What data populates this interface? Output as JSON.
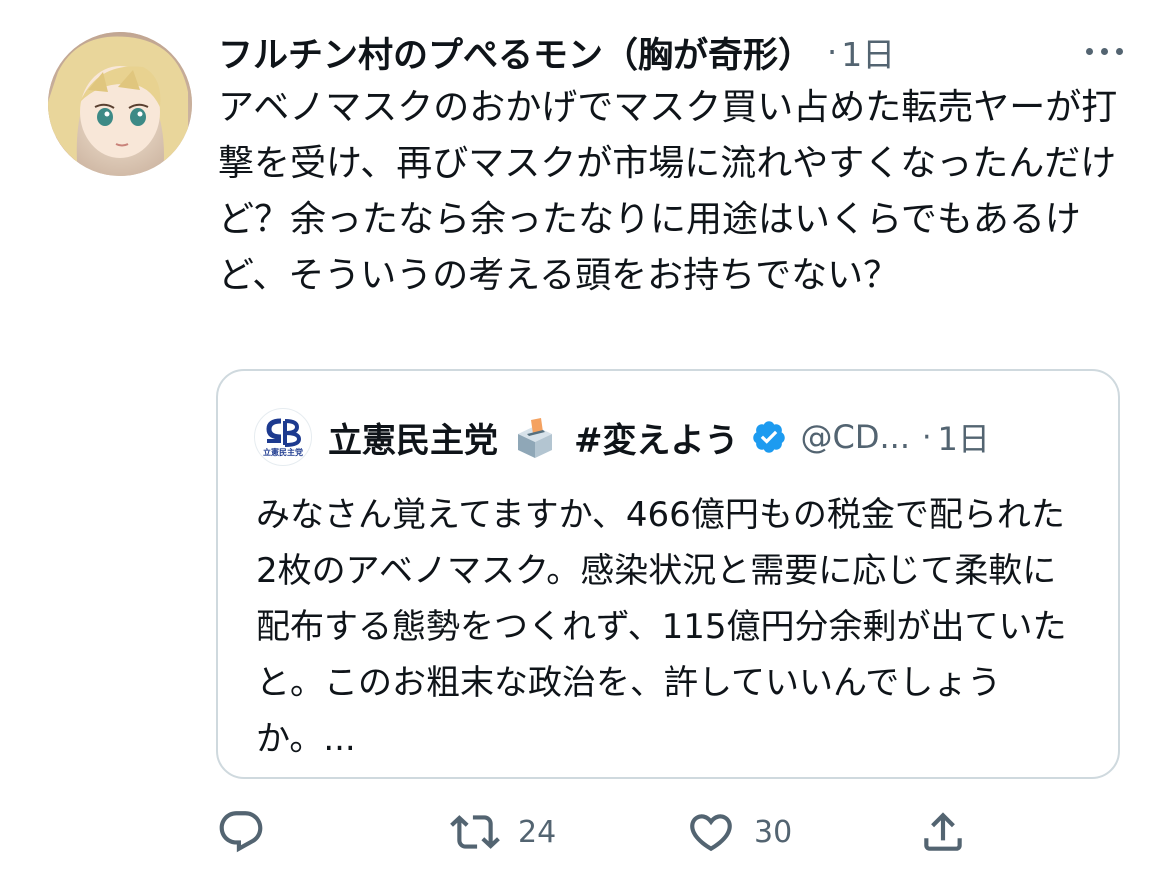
{
  "tweet": {
    "display_name": "フルチン村のプぺるモン（胸が奇形）",
    "separator": "·",
    "time": "1日",
    "more_icon": "more-dots-icon",
    "text": "アベノマスクのおかげでマスク買い占めた転売ヤーが打撃を受け、再びマスクが市場に流れやすくなったんだけど？余ったなら余ったなりに用途はいくらでもあるけど、そういうの考える頭をお持ちでない？"
  },
  "quote": {
    "avatar_logo": "CDP",
    "avatar_caption": "立憲民主党",
    "display_name": "立憲民主党",
    "ballot_icon": "ballot-box-icon",
    "hashtag": "#変えよう",
    "verified_icon": "verified-badge-icon",
    "handle": "@CD...",
    "separator": "·",
    "time": "1日",
    "text": "みなさん覚えてますか、466億円もの税金で配られた2枚のアベノマスク。感染状況と需要に応じて柔軟に配布する態勢をつくれず、115億円分余剰が出ていたと。このお粗末な政治を、許していいんでしょうか。..."
  },
  "actions": {
    "reply_icon": "reply-icon",
    "retweet_icon": "retweet-icon",
    "retweet_count": "24",
    "like_icon": "heart-icon",
    "like_count": "30",
    "share_icon": "share-icon"
  },
  "colors": {
    "text_primary": "#0f1419",
    "text_secondary": "#536471",
    "border": "#cfd9de",
    "verified": "#1d9bf0"
  }
}
